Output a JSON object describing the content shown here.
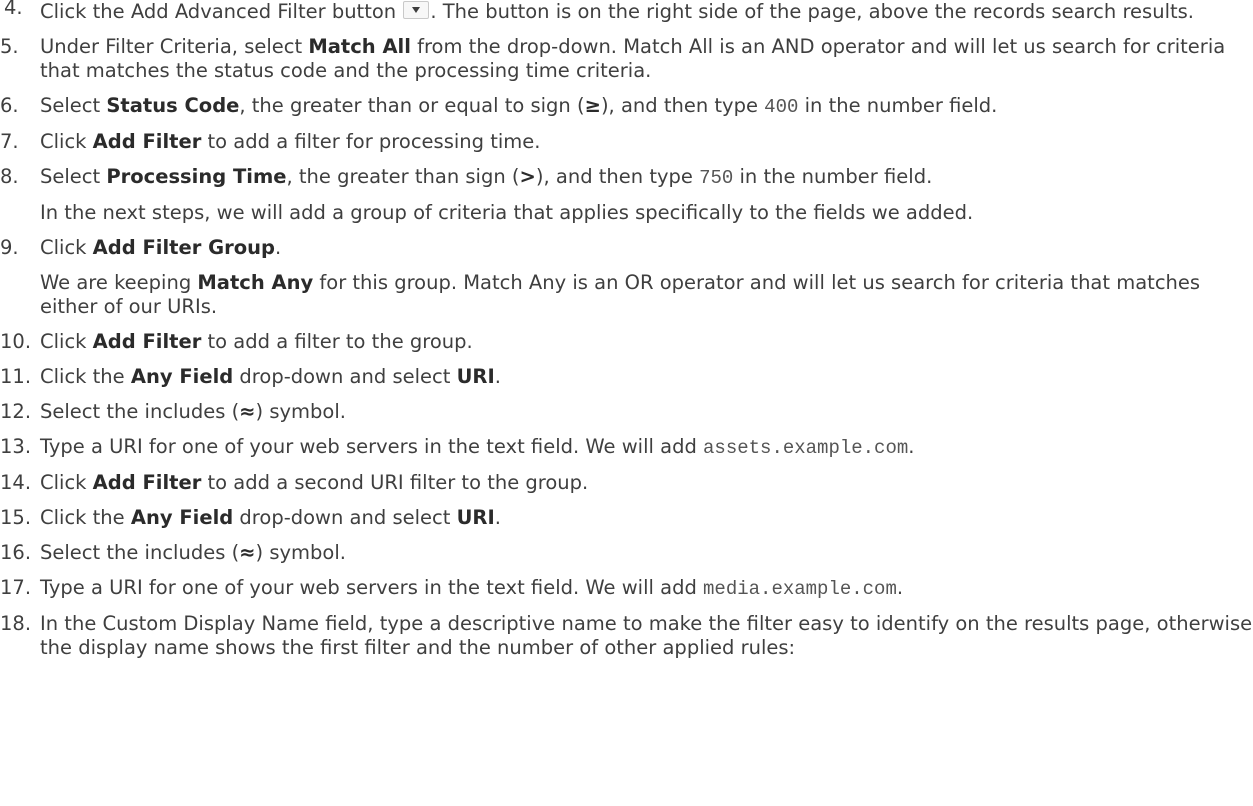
{
  "steps": [
    {
      "num": "4.",
      "parts": [
        {
          "t": "Click the Add Advanced Filter button "
        },
        {
          "t": "",
          "style": "icon",
          "icon": "filter-icon"
        },
        {
          "t": ". The button is on the right side of the page, above the records search results."
        }
      ]
    },
    {
      "num": "5.",
      "parts": [
        {
          "t": "Under Filter Criteria, select "
        },
        {
          "t": "Match All",
          "style": "b"
        },
        {
          "t": " from the drop-down. Match All is an AND operator and will let us search for criteria that matches the status code and the processing time criteria."
        }
      ]
    },
    {
      "num": "6.",
      "parts": [
        {
          "t": "Select "
        },
        {
          "t": "Status Code",
          "style": "b"
        },
        {
          "t": ", the greater than or equal to sign ("
        },
        {
          "t": "≥",
          "style": "b"
        },
        {
          "t": "), and then type "
        },
        {
          "t": "400",
          "style": "code"
        },
        {
          "t": " in the number field."
        }
      ]
    },
    {
      "num": "7.",
      "parts": [
        {
          "t": "Click "
        },
        {
          "t": "Add Filter",
          "style": "b"
        },
        {
          "t": " to add a filter for processing time."
        }
      ]
    },
    {
      "num": "8.",
      "parts": [
        {
          "t": "Select "
        },
        {
          "t": "Processing Time",
          "style": "b"
        },
        {
          "t": ", the greater than sign ("
        },
        {
          "t": ">",
          "style": "b"
        },
        {
          "t": "), and then type "
        },
        {
          "t": "750",
          "style": "code"
        },
        {
          "t": " in the number field."
        }
      ],
      "note": [
        {
          "t": "In the next steps, we will add a group of criteria that applies specifically to the fields we added."
        }
      ]
    },
    {
      "num": "9.",
      "parts": [
        {
          "t": "Click "
        },
        {
          "t": "Add Filter Group",
          "style": "b"
        },
        {
          "t": "."
        }
      ],
      "note": [
        {
          "t": "We are keeping "
        },
        {
          "t": "Match Any",
          "style": "b"
        },
        {
          "t": " for this group. Match Any is an OR operator and will let us search for criteria that matches either of our URIs."
        }
      ]
    },
    {
      "num": "10.",
      "parts": [
        {
          "t": "Click "
        },
        {
          "t": "Add Filter",
          "style": "b"
        },
        {
          "t": " to add a filter to the group."
        }
      ]
    },
    {
      "num": "11.",
      "parts": [
        {
          "t": "Click the "
        },
        {
          "t": "Any Field",
          "style": "b"
        },
        {
          "t": " drop-down and select "
        },
        {
          "t": "URI",
          "style": "b"
        },
        {
          "t": "."
        }
      ]
    },
    {
      "num": "12.",
      "parts": [
        {
          "t": "Select the includes ("
        },
        {
          "t": "≈",
          "style": "b"
        },
        {
          "t": ") symbol."
        }
      ]
    },
    {
      "num": "13.",
      "parts": [
        {
          "t": "Type a URI for one of your web servers in the text field. We will add "
        },
        {
          "t": "assets.example.com",
          "style": "code"
        },
        {
          "t": "."
        }
      ]
    },
    {
      "num": "14.",
      "parts": [
        {
          "t": "Click "
        },
        {
          "t": "Add Filter",
          "style": "b"
        },
        {
          "t": " to add a second URI filter to the group."
        }
      ]
    },
    {
      "num": "15.",
      "parts": [
        {
          "t": "Click the "
        },
        {
          "t": "Any Field",
          "style": "b"
        },
        {
          "t": " drop-down and select "
        },
        {
          "t": "URI",
          "style": "b"
        },
        {
          "t": "."
        }
      ]
    },
    {
      "num": "16.",
      "parts": [
        {
          "t": "Select the includes ("
        },
        {
          "t": "≈",
          "style": "b"
        },
        {
          "t": ") symbol."
        }
      ]
    },
    {
      "num": "17.",
      "parts": [
        {
          "t": "Type a URI for one of your web servers in the text field. We will add "
        },
        {
          "t": "media.example.com",
          "style": "code"
        },
        {
          "t": "."
        }
      ]
    },
    {
      "num": "18.",
      "parts": [
        {
          "t": "In the Custom Display Name field, type a descriptive name to make the filter easy to identify on the results page, otherwise the display name shows the first filter and the number of other applied rules:"
        }
      ]
    }
  ]
}
